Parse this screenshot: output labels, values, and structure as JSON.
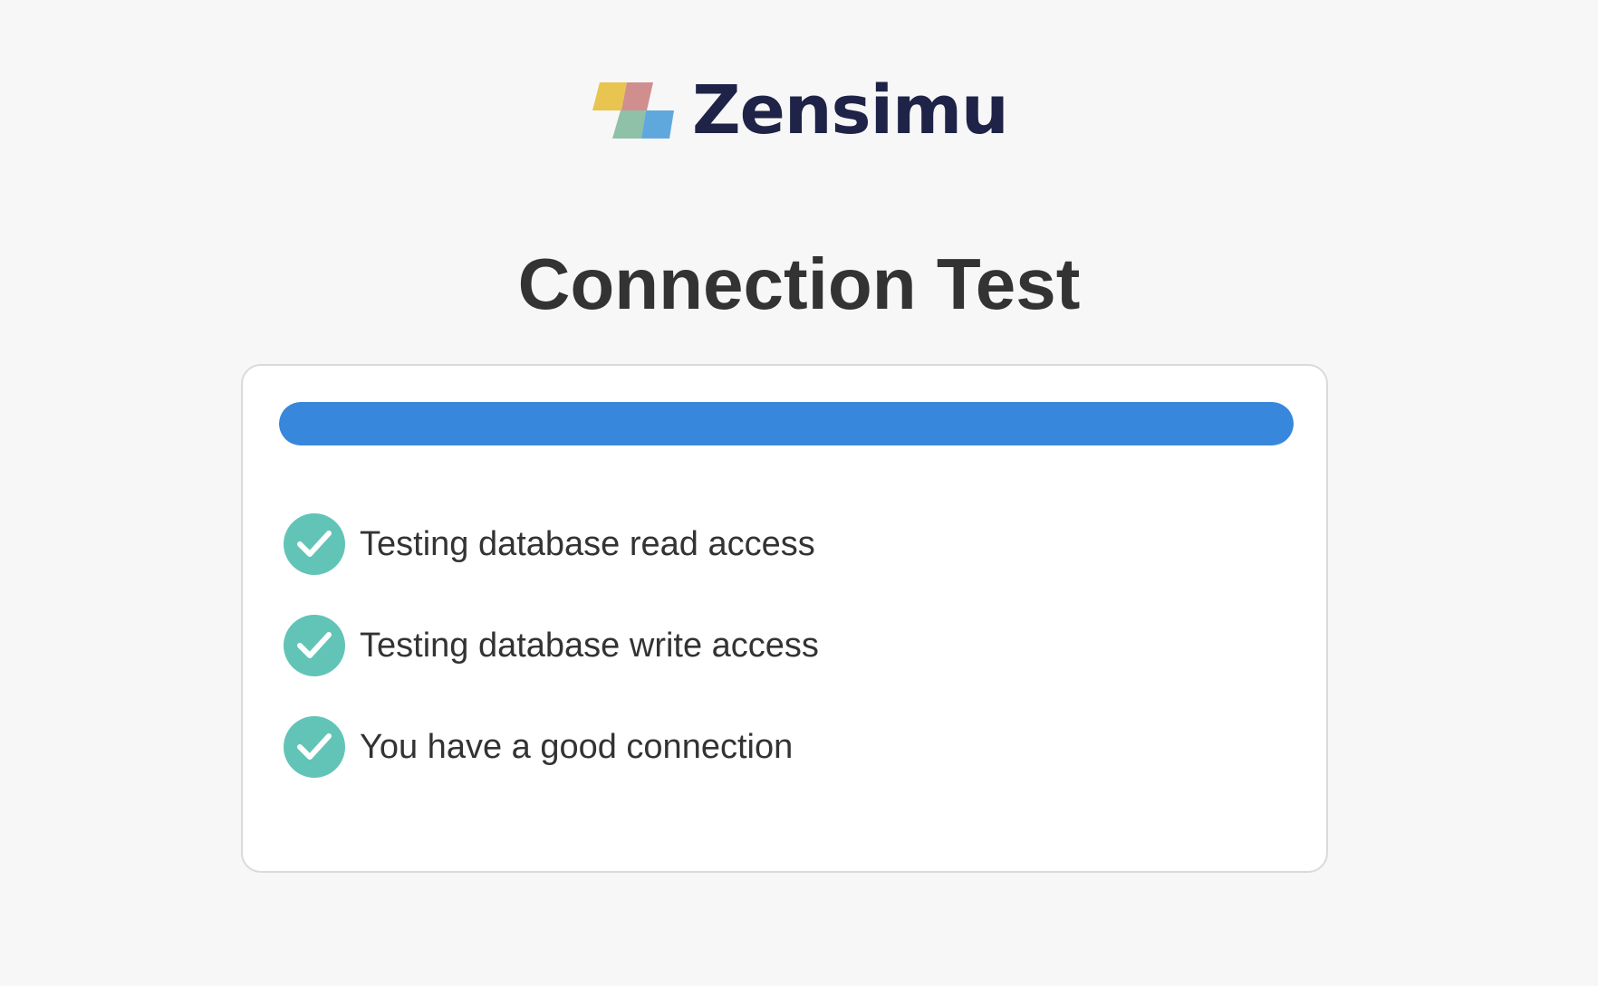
{
  "brand": {
    "name": "Zensimu",
    "icon": "zensimu-logo-mark",
    "colors": {
      "text": "#1e2347",
      "yellow": "#e8c450",
      "pink": "#d18e8e",
      "green": "#8fc0a8",
      "blue": "#5fa8dd"
    }
  },
  "page": {
    "title": "Connection Test"
  },
  "progress": {
    "fraction": 1.0,
    "color": "#3787dc"
  },
  "checks": [
    {
      "label": "Testing database read access",
      "status": "success",
      "icon": "check-circle-icon"
    },
    {
      "label": "Testing database write access",
      "status": "success",
      "icon": "check-circle-icon"
    },
    {
      "label": "You have a good connection",
      "status": "success",
      "icon": "check-circle-icon"
    }
  ],
  "colors": {
    "background": "#f7f7f7",
    "card": "#ffffff",
    "card_border": "#dadada",
    "text": "#333333",
    "success": "#62c4b7"
  }
}
